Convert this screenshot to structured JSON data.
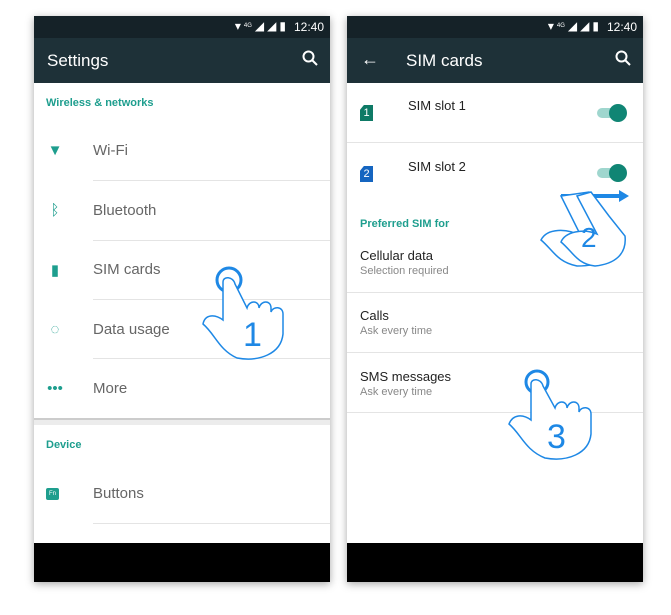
{
  "status_bar": {
    "time": "12:40",
    "network": "4G"
  },
  "settings_screen": {
    "title": "Settings",
    "sections": [
      {
        "header": "Wireless & networks",
        "items": [
          {
            "label": "Wi-Fi",
            "icon": "wifi-icon"
          },
          {
            "label": "Bluetooth",
            "icon": "bluetooth-icon"
          },
          {
            "label": "SIM cards",
            "icon": "sim-card-icon"
          },
          {
            "label": "Data usage",
            "icon": "data-usage-icon"
          },
          {
            "label": "More",
            "icon": "more-icon"
          }
        ]
      },
      {
        "header": "Device",
        "items": [
          {
            "label": "Buttons",
            "icon": "fn-buttons-icon",
            "icon_text": "Fn"
          }
        ]
      }
    ]
  },
  "sim_screen": {
    "title": "SIM cards",
    "slots": [
      {
        "label": "SIM slot 1",
        "number": "1",
        "color": "#0e7a66",
        "enabled": true
      },
      {
        "label": "SIM slot 2",
        "number": "2",
        "color": "#1565c0",
        "enabled": true
      }
    ],
    "preferred_header": "Preferred SIM for",
    "preferences": [
      {
        "title": "Cellular data",
        "subtitle": "Selection required"
      },
      {
        "title": "Calls",
        "subtitle": "Ask every time"
      },
      {
        "title": "SMS messages",
        "subtitle": "Ask every time"
      }
    ]
  },
  "gestures": [
    {
      "step": "1"
    },
    {
      "step": "2"
    },
    {
      "step": "3"
    }
  ],
  "colors": {
    "accent": "#1e9e8e",
    "toolbar": "#1e3138",
    "gesture": "#1e88e5"
  }
}
